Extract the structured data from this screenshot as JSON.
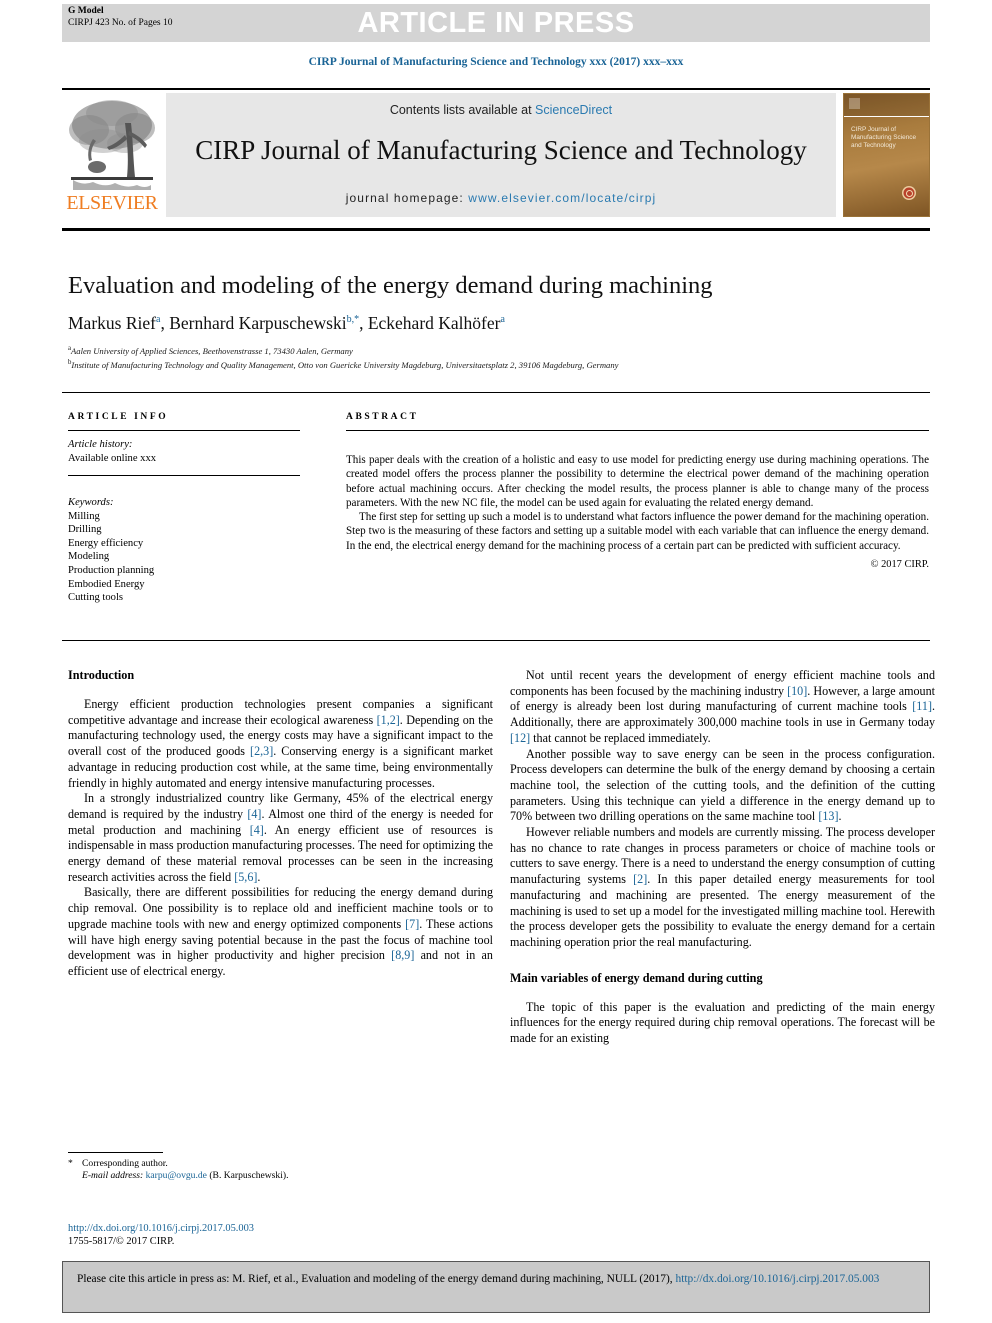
{
  "banner": {
    "g_model": "G Model",
    "article_id": "CIRPJ 423 No. of Pages 10",
    "press_text": "ARTICLE IN PRESS"
  },
  "journal_ref": "CIRP Journal of Manufacturing Science and Technology xxx (2017) xxx–xxx",
  "masthead": {
    "contents_prefix": "Contents lists available at ",
    "sciencedirect": "ScienceDirect",
    "journal_title": "CIRP Journal of Manufacturing Science and Technology",
    "homepage_label": "journal homepage: ",
    "homepage_url": "www.elsevier.com/locate/cirpj",
    "publisher": "ELSEVIER",
    "cover_title": "CIRP Journal of Manufacturing Science and Technology",
    "accent_link": "#2a7ab0",
    "elsevier_orange": "#ef7d22"
  },
  "article": {
    "title": "Evaluation and modeling of the energy demand during machining",
    "authors_html": "Markus Rief<sup>a</sup>, Bernhard Karpuschewski<sup>b,*</sup>, Eckehard Kalhöfer<sup>a</sup>",
    "affiliation_a": "Aalen University of Applied Sciences, Beethovenstrasse 1, 73430 Aalen, Germany",
    "affiliation_b": "Institute of Manufacturing Technology and Quality Management, Otto von Guericke University Magdeburg, Universitaetsplatz 2, 39106 Magdeburg, Germany"
  },
  "info": {
    "heading": "ARTICLE INFO",
    "history_label": "Article history:",
    "history_value": "Available online xxx",
    "keywords_label": "Keywords:",
    "keywords": [
      "Milling",
      "Drilling",
      "Energy efficiency",
      "Modeling",
      "Production planning",
      "Embodied Energy",
      "Cutting tools"
    ]
  },
  "abstract": {
    "heading": "ABSTRACT",
    "paragraph_1": "This paper deals with the creation of a holistic and easy to use model for predicting energy use during machining operations. The created model offers the process planner the possibility to determine the electrical power demand of the machining operation before actual machining occurs. After checking the model results, the process planner is able to change many of the process parameters. With the new NC file, the model can be used again for evaluating the related energy demand.",
    "paragraph_2": "The first step for setting up such a model is to understand what factors influence the power demand for the machining operation. Step two is the measuring of these factors and setting up a suitable model with each variable that can influence the energy demand. In the end, the electrical energy demand for the machining process of a certain part can be predicted with sufficient accuracy.",
    "copyright": "© 2017 CIRP."
  },
  "body": {
    "left_heading": "Introduction",
    "left_paragraphs": [
      "Energy efficient production technologies present companies a significant competitive advantage and increase their ecological awareness [1,2]. Depending on the manufacturing technology used, the energy costs may have a significant impact to the overall cost of the produced goods [2,3]. Conserving energy is a significant market advantage in reducing production cost while, at the same time, being environmentally friendly in highly automated and energy intensive manufacturing processes.",
      "In a strongly industrialized country like Germany, 45% of the electrical energy demand is required by the industry [4]. Almost one third of the energy is needed for metal production and machining [4]. An energy efficient use of resources is indispensable in mass production manufacturing processes. The need for optimizing the energy demand of these material removal processes can be seen in the increasing research activities across the field [5,6].",
      "Basically, there are different possibilities for reducing the energy demand during chip removal. One possibility is to replace old and inefficient machine tools or to upgrade machine tools with new and energy optimized components [7]. These actions will have high energy saving potential because in the past the focus of machine tool development was in higher productivity and higher precision [8,9] and not in an efficient use of electrical energy."
    ],
    "right_paragraphs": [
      "Not until recent years the development of energy efficient machine tools and components has been focused by the machining industry [10]. However, a large amount of energy is already been lost during manufacturing of current machine tools [11]. Additionally, there are approximately 300,000 machine tools in use in Germany today [12] that cannot be replaced immediately.",
      "Another possible way to save energy can be seen in the process configuration. Process developers can determine the bulk of the energy demand by choosing a certain machine tool, the selection of the cutting tools, and the definition of the cutting parameters. Using this technique can yield a difference in the energy demand up to 70% between two drilling operations on the same machine tool [13].",
      "However reliable numbers and models are currently missing. The process developer has no chance to rate changes in process parameters or choice of machine tools or cutters to save energy. There is a need to understand the energy consumption of cutting manufacturing systems [2]. In this paper detailed energy measurements for tool manufacturing and machining are presented. The energy measurement of the machining is used to set up a model for the investigated milling machine tool. Herewith the process developer gets the possibility to evaluate the energy demand for a certain machining operation prior the real manufacturing."
    ],
    "right_heading_2": "Main variables of energy demand during cutting",
    "right_paragraph_after_heading": "The topic of this paper is the evaluation and predicting of the main energy influences for the energy required during chip removal operations. The forecast will be made for an existing"
  },
  "footnote": {
    "star": "*",
    "corresponding": "Corresponding author.",
    "email_label": "E-mail address:",
    "email": "karpu@ovgu.de",
    "email_owner": "(B. Karpuschewski).",
    "doi_url": "http://dx.doi.org/10.1016/j.cirpj.2017.05.003",
    "issn_line": "1755-5817/© 2017 CIRP."
  },
  "cite_box": {
    "text_prefix": "Please cite this article in press as: M. Rief, et al., Evaluation and modeling of the energy demand during machining, NULL (2017), ",
    "link": "http://dx.doi.org/10.1016/j.cirpj.2017.05.003"
  }
}
